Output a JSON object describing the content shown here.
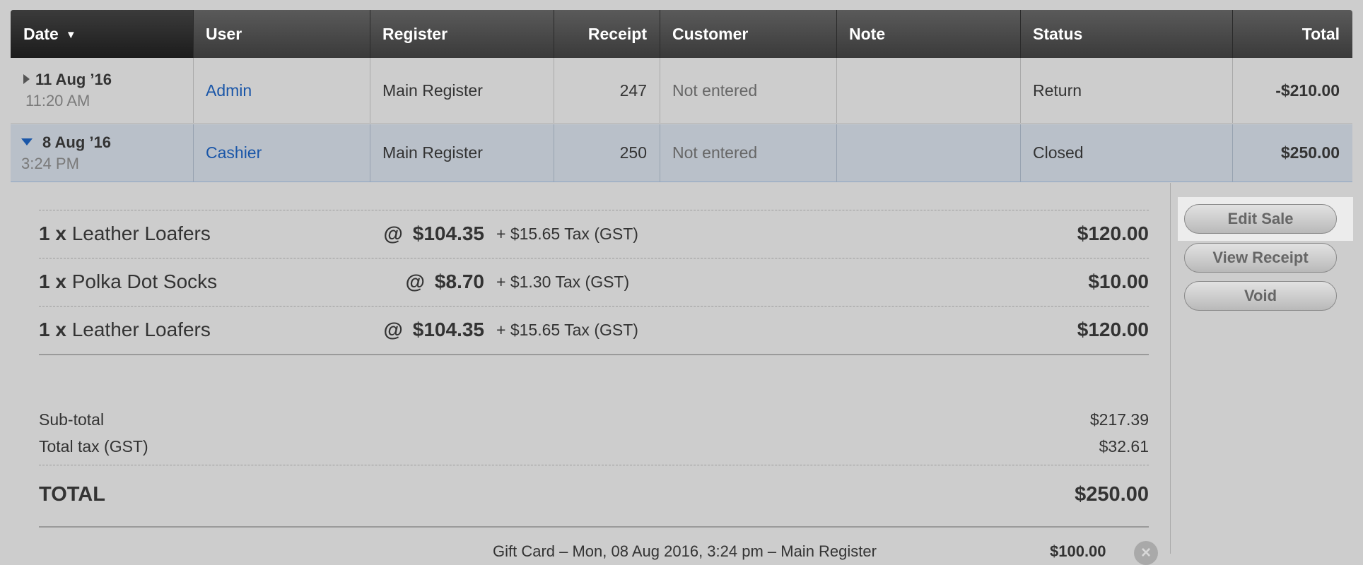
{
  "table": {
    "headers": {
      "date": "Date",
      "user": "User",
      "register": "Register",
      "receipt": "Receipt",
      "customer": "Customer",
      "note": "Note",
      "status": "Status",
      "total": "Total"
    },
    "rows": [
      {
        "date": "11 Aug ’16",
        "time": "11:20 AM",
        "user": "Admin",
        "register": "Main Register",
        "receipt": "247",
        "customer": "Not entered",
        "note": "",
        "status": "Return",
        "total": "-$210.00",
        "expanded": false
      },
      {
        "date": "8 Aug ’16",
        "time": "3:24 PM",
        "user": "Cashier",
        "register": "Main Register",
        "receipt": "250",
        "customer": "Not entered",
        "note": "",
        "status": "Closed",
        "total": "$250.00",
        "expanded": true
      }
    ]
  },
  "detail": {
    "items": [
      {
        "qty": "1 x",
        "name": "Leather Loafers",
        "at": "@",
        "price": "$104.35",
        "tax": "+ $15.65 Tax (GST)",
        "total": "$120.00"
      },
      {
        "qty": "1 x",
        "name": "Polka Dot Socks",
        "at": "@",
        "price": "$8.70",
        "tax": "+ $1.30 Tax (GST)",
        "total": "$10.00"
      },
      {
        "qty": "1 x",
        "name": "Leather Loafers",
        "at": "@",
        "price": "$104.35",
        "tax": "+ $15.65 Tax (GST)",
        "total": "$120.00"
      }
    ],
    "subtotal_label": "Sub-total",
    "subtotal_value": "$217.39",
    "tax_label": "Total tax (GST)",
    "tax_value": "$32.61",
    "total_label": "TOTAL",
    "total_value": "$250.00",
    "payment": {
      "description": "Gift Card – Mon, 08 Aug 2016, 3:24 pm – Main Register",
      "amount": "$100.00",
      "remove_glyph": "×"
    }
  },
  "actions": {
    "edit_sale": "Edit Sale",
    "view_receipt": "View Receipt",
    "void": "Void"
  },
  "colors": {
    "header_bg": "#444444",
    "selected_row_bg": "#b9c0c9",
    "link": "#1a56a8",
    "page_bg": "#cdcdcd"
  }
}
